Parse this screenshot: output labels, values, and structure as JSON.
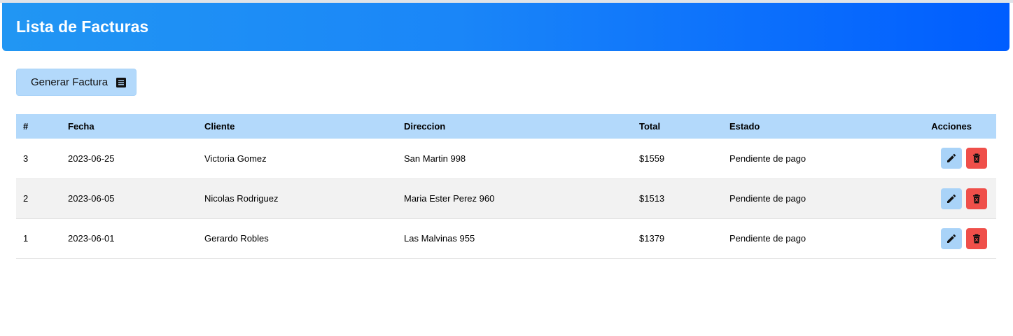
{
  "header": {
    "title": "Lista de Facturas"
  },
  "toolbar": {
    "generate_label": "Generar Factura",
    "generate_icon": "list-document-icon"
  },
  "table": {
    "columns": [
      "#",
      "Fecha",
      "Cliente",
      "Direccion",
      "Total",
      "Estado",
      "Acciones"
    ],
    "rows": [
      {
        "id": "3",
        "fecha": "2023-06-25",
        "cliente": "Victoria Gomez",
        "direccion": "San Martin 998",
        "total": "$1559",
        "estado": "Pendiente de pago"
      },
      {
        "id": "2",
        "fecha": "2023-06-05",
        "cliente": "Nicolas Rodriguez",
        "direccion": "Maria Ester Perez 960",
        "total": "$1513",
        "estado": "Pendiente de pago"
      },
      {
        "id": "1",
        "fecha": "2023-06-01",
        "cliente": "Gerardo Robles",
        "direccion": "Las Malvinas 955",
        "total": "$1379",
        "estado": "Pendiente de pago"
      }
    ]
  },
  "colors": {
    "header_gradient_start": "#2196f3",
    "header_gradient_end": "#005dff",
    "accent_light": "#b3d9fb",
    "delete": "#ef4f4a"
  }
}
